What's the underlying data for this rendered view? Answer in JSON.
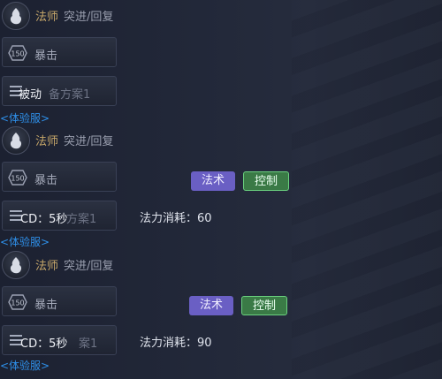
{
  "blocks": [
    {
      "hero_name": "法师",
      "hero_action": "突进/回复",
      "tag1_text": "暴击",
      "badge_text": "150",
      "tag2_ghost": "备方案1",
      "tag2_overlay": "被动",
      "trial_label": "<体验服>"
    },
    {
      "hero_name": "法师",
      "hero_action": "突进/回复",
      "tag1_text": "暴击",
      "badge_text": "150",
      "tag2_ghost": "方案1",
      "cd_text": "CD：5秒",
      "skill_type": "法术",
      "skill_effect": "控制",
      "mana_cost": "法力消耗：60",
      "trial_label": "<体验服>"
    },
    {
      "hero_name": "法师",
      "hero_action": "突进/回复",
      "tag1_text": "暴击",
      "badge_text": "150",
      "tag2_ghost": "案1",
      "cd_text": "CD：5秒",
      "skill_type": "法术",
      "skill_effect": "控制",
      "mana_cost": "法力消耗：90",
      "trial_label": "<体验服>"
    }
  ],
  "colors": {
    "hero_name": "#c8a86a",
    "trial": "#2e8fe8",
    "magic_tag": "#6a5fc4",
    "control_tag": "#3a7a46"
  }
}
